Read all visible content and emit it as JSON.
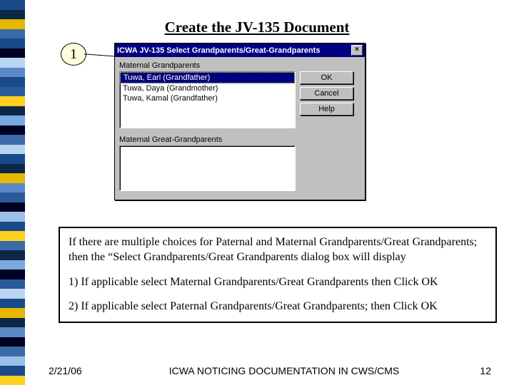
{
  "page": {
    "title": "Create the JV-135 Document"
  },
  "callout": {
    "number": "1"
  },
  "dialog": {
    "title": "ICWA JV-135 Select Grandparents/Great-Grandparents",
    "close": "×",
    "section1": {
      "label": "Maternal Grandparents",
      "items": [
        "Tuwa, Earl (Grandfather)",
        "Tuwa, Daya (Grandmother)",
        "Tuwa, Kamal (Grandfather)"
      ]
    },
    "section2": {
      "label": "Maternal Great-Grandparents"
    },
    "buttons": {
      "ok": "OK",
      "cancel": "Cancel",
      "help": "Help"
    }
  },
  "instructions": {
    "para1": "If there are multiple choices for Paternal and Maternal Grandparents/Great Grandparents; then the “Select Grandparents/Great Grandparents dialog box will display",
    "para2": "1) If applicable select Maternal Grandparents/Great Grandparents then Click OK",
    "para3": "2) If applicable select Paternal Grandparents/Great Grandparents; then Click OK"
  },
  "footer": {
    "date": "2/21/06",
    "center": "ICWA NOTICING DOCUMENTATION IN CWS/CMS",
    "page": "12"
  }
}
